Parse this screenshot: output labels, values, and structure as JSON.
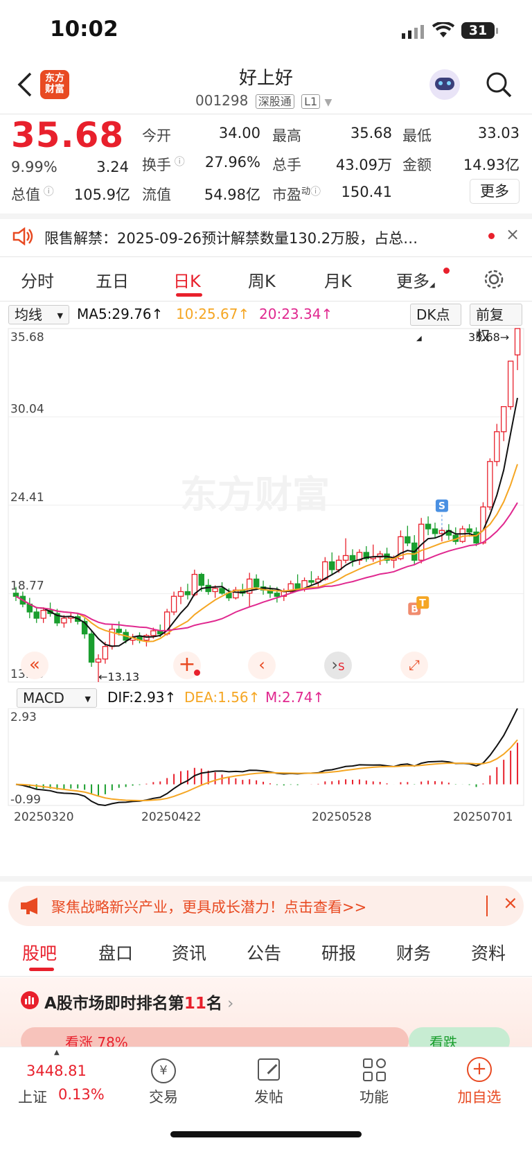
{
  "status_bar": {
    "time": "10:02",
    "battery": "31"
  },
  "header": {
    "logo_line1": "东方",
    "logo_line2": "财富",
    "title": "好上好",
    "code": "001298",
    "tag1": "深股通",
    "tag2": "L1"
  },
  "quote": {
    "price": "35.68",
    "change_pct": "9.99%",
    "change": "3.24",
    "open_label": "今开",
    "open": "34.00",
    "high_label": "最高",
    "high": "35.68",
    "low_label": "最低",
    "low": "33.03",
    "turnover_label": "换手",
    "turnover": "27.96%",
    "volume_label": "总手",
    "volume": "43.09万",
    "amount_label": "金额",
    "amount": "14.93亿",
    "mcap_label": "总值",
    "mcap": "105.9亿",
    "float_label": "流值",
    "float": "54.98亿",
    "pe_label": "市盈",
    "pe_sup": "动",
    "pe": "150.41",
    "more": "更多"
  },
  "notice": {
    "text": "限售解禁：2025-09-26预计解禁数量130.2万股，占总…"
  },
  "chart_tabs": [
    "分时",
    "五日",
    "日K",
    "周K",
    "月K",
    "更多"
  ],
  "chart_controls": {
    "ma_select": "均线",
    "ma5": "MA5:29.76",
    "ma10": "10:25.67",
    "ma20": "20:23.34",
    "dk": "DK点",
    "adjust": "前复权",
    "watermark": "东方财富"
  },
  "colors": {
    "up": "#e8202c",
    "down": "#1a9e2e",
    "ma5": "#111111",
    "ma10": "#f5a623",
    "ma20": "#e0288f",
    "brand": "#e84a22"
  },
  "chart_data": [
    {
      "type": "candlestick",
      "title": "日K",
      "y_tick_labels": [
        "35.68",
        "30.04",
        "24.41",
        "18.77",
        "13.13"
      ],
      "ylim": [
        13.13,
        35.68
      ],
      "x_tick_labels": [
        "20250320",
        "20250422",
        "20250528",
        "20250701"
      ],
      "annotations": [
        "35.68→",
        "←13.13",
        "S",
        "B",
        "T"
      ],
      "series": [
        {
          "name": "MA5",
          "last": 29.76
        },
        {
          "name": "10",
          "last": 25.67
        },
        {
          "name": "20",
          "last": 23.34
        }
      ],
      "ohlc": [
        [
          18.8,
          19.2,
          18.3,
          18.6
        ],
        [
          18.6,
          18.9,
          17.9,
          18.1
        ],
        [
          18.1,
          18.5,
          17.2,
          17.6
        ],
        [
          17.6,
          17.9,
          16.9,
          17.2
        ],
        [
          17.2,
          17.9,
          16.9,
          17.7
        ],
        [
          17.7,
          18.2,
          17.3,
          17.5
        ],
        [
          17.5,
          17.8,
          16.7,
          16.9
        ],
        [
          16.9,
          17.4,
          16.6,
          17.2
        ],
        [
          17.2,
          17.6,
          16.9,
          17.3
        ],
        [
          17.3,
          17.5,
          16.8,
          17.0
        ],
        [
          17.0,
          17.2,
          15.9,
          16.2
        ],
        [
          16.2,
          16.4,
          14.1,
          14.4
        ],
        [
          14.4,
          14.9,
          13.13,
          14.6
        ],
        [
          14.6,
          15.7,
          14.3,
          15.4
        ],
        [
          15.4,
          16.8,
          15.2,
          16.5
        ],
        [
          16.5,
          17.0,
          16.1,
          16.3
        ],
        [
          16.3,
          16.5,
          15.6,
          15.8
        ],
        [
          15.8,
          16.2,
          15.5,
          16.0
        ],
        [
          16.0,
          16.3,
          15.6,
          15.8
        ],
        [
          15.8,
          16.2,
          15.4,
          16.1
        ],
        [
          16.1,
          16.6,
          15.9,
          16.4
        ],
        [
          16.4,
          16.8,
          16.0,
          16.2
        ],
        [
          16.2,
          17.8,
          16.1,
          17.6
        ],
        [
          17.6,
          18.9,
          17.4,
          18.6
        ],
        [
          18.6,
          19.2,
          18.1,
          18.9
        ],
        [
          18.9,
          19.4,
          18.4,
          18.7
        ],
        [
          18.7,
          20.3,
          18.6,
          20.0
        ],
        [
          20.0,
          20.1,
          18.9,
          19.3
        ],
        [
          19.3,
          19.7,
          18.7,
          18.9
        ],
        [
          18.9,
          19.3,
          18.5,
          19.1
        ],
        [
          19.1,
          19.5,
          18.7,
          18.8
        ],
        [
          18.8,
          19.1,
          18.3,
          18.5
        ],
        [
          18.5,
          19.2,
          18.4,
          19.0
        ],
        [
          19.0,
          19.4,
          18.6,
          18.8
        ],
        [
          18.8,
          20.1,
          17.9,
          19.7
        ],
        [
          19.7,
          20.0,
          19.0,
          19.2
        ],
        [
          19.2,
          19.6,
          18.7,
          19.0
        ],
        [
          19.0,
          19.3,
          18.5,
          18.8
        ],
        [
          18.8,
          19.2,
          18.2,
          18.6
        ],
        [
          18.6,
          19.1,
          18.3,
          18.9
        ],
        [
          18.9,
          19.6,
          18.8,
          19.4
        ],
        [
          19.4,
          20.0,
          19.0,
          19.1
        ],
        [
          19.1,
          19.8,
          18.9,
          19.6
        ],
        [
          19.6,
          20.2,
          19.3,
          19.5
        ],
        [
          19.5,
          19.9,
          19.1,
          19.7
        ],
        [
          19.7,
          21.1,
          19.6,
          20.8
        ],
        [
          20.8,
          21.4,
          20.0,
          20.3
        ],
        [
          20.3,
          21.2,
          20.1,
          20.9
        ],
        [
          20.9,
          22.3,
          20.7,
          21.2
        ],
        [
          21.2,
          21.6,
          20.5,
          20.9
        ],
        [
          20.9,
          21.6,
          20.6,
          21.4
        ],
        [
          21.4,
          21.8,
          20.8,
          21.0
        ],
        [
          21.0,
          21.9,
          20.8,
          21.1
        ],
        [
          21.1,
          21.5,
          20.6,
          21.3
        ],
        [
          21.3,
          21.7,
          20.7,
          20.9
        ],
        [
          20.9,
          21.2,
          20.4,
          21.0
        ],
        [
          21.0,
          22.8,
          20.9,
          22.4
        ],
        [
          22.4,
          23.1,
          21.8,
          22.0
        ],
        [
          22.0,
          22.5,
          20.6,
          20.9
        ],
        [
          20.9,
          23.6,
          20.7,
          23.2
        ],
        [
          23.2,
          23.7,
          22.5,
          22.9
        ],
        [
          22.9,
          23.3,
          22.3,
          22.6
        ],
        [
          22.6,
          23.0,
          22.1,
          22.8
        ],
        [
          22.8,
          23.2,
          22.2,
          22.5
        ],
        [
          22.5,
          23.0,
          21.9,
          22.1
        ],
        [
          22.1,
          23.1,
          22.0,
          22.9
        ],
        [
          22.9,
          23.2,
          22.4,
          22.7
        ],
        [
          22.7,
          23.0,
          21.8,
          22.0
        ],
        [
          22.0,
          24.6,
          21.9,
          24.3
        ],
        [
          24.3,
          27.4,
          24.1,
          27.2
        ],
        [
          27.2,
          29.6,
          26.9,
          29.1
        ],
        [
          29.1,
          30.7,
          28.5,
          30.7
        ],
        [
          30.7,
          33.03,
          30.5,
          33.6
        ],
        [
          34.0,
          35.68,
          33.03,
          35.68
        ]
      ]
    },
    {
      "type": "bar",
      "title": "MACD",
      "series": [
        {
          "name": "DIF",
          "last": 2.93
        },
        {
          "name": "DEA",
          "last": 1.56
        },
        {
          "name": "M",
          "last": 2.74
        }
      ],
      "y_tick_labels": [
        "2.93",
        "-0.99"
      ],
      "ylim": [
        -0.99,
        2.93
      ]
    }
  ],
  "chart_nav": {
    "low_label": "←13.13",
    "high_label": "35.68→"
  },
  "macd": {
    "select": "MACD",
    "dif": "DIF:2.93",
    "dea": "DEA:1.56",
    "m": "M:2.74"
  },
  "banner": {
    "text": "聚焦战略新兴产业，更具成长潜力！点击查看>>"
  },
  "bottom_tabs": [
    "股吧",
    "盘口",
    "资讯",
    "公告",
    "研报",
    "财务",
    "资料"
  ],
  "rank": {
    "text_prefix": "A股市场即时排名第",
    "rank": "11",
    "text_suffix": "名",
    "up_label": "看涨 78%",
    "down_label": "看跌"
  },
  "nav": {
    "index_value": "3448.81",
    "index_name": "上证",
    "index_pct": "0.13%",
    "trade": "交易",
    "post": "发帖",
    "func": "功能",
    "watch": "加自选"
  }
}
